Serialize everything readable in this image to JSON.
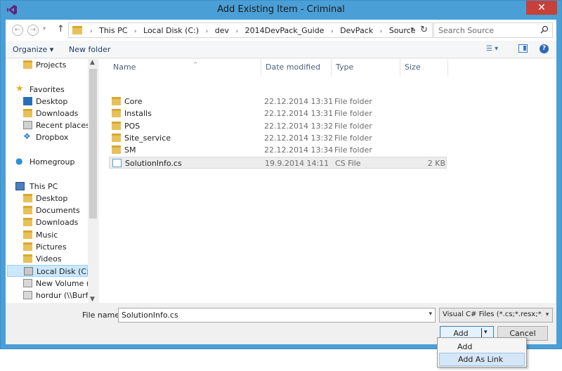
{
  "window": {
    "title": "Add Existing Item - Criminal",
    "close_glyph": "✕"
  },
  "address": {
    "crumbs": [
      "This PC",
      "Local Disk (C:)",
      "dev",
      "2014DevPack_Guide",
      "DevPack",
      "Source"
    ],
    "search_placeholder": "Search Source"
  },
  "toolbar": {
    "organize": "Organize ▾",
    "new_folder": "New folder"
  },
  "nav": {
    "items": [
      {
        "label": "Projects",
        "icon": "folder-icon"
      },
      {
        "label": "Favorites",
        "icon": "star-icon"
      },
      {
        "label": "Desktop",
        "icon": "desktop-icon"
      },
      {
        "label": "Downloads",
        "icon": "downloads-icon"
      },
      {
        "label": "Recent places",
        "icon": "recent-places-icon"
      },
      {
        "label": "Dropbox",
        "icon": "dropbox-icon"
      },
      {
        "label": "Homegroup",
        "icon": "homegroup-icon"
      },
      {
        "label": "This PC",
        "icon": "computer-icon"
      },
      {
        "label": "Desktop",
        "icon": "desktop-icon"
      },
      {
        "label": "Documents",
        "icon": "documents-icon"
      },
      {
        "label": "Downloads",
        "icon": "downloads-icon"
      },
      {
        "label": "Music",
        "icon": "music-icon"
      },
      {
        "label": "Pictures",
        "icon": "pictures-icon"
      },
      {
        "label": "Videos",
        "icon": "videos-icon"
      },
      {
        "label": "Local Disk (C:)",
        "icon": "drive-icon"
      },
      {
        "label": "New Volume (D:)",
        "icon": "drive-icon"
      },
      {
        "label": "hordur (\\\\Burfell.",
        "icon": "network-drive-icon"
      }
    ]
  },
  "files": {
    "columns": [
      "Name",
      "Date modified",
      "Type",
      "Size"
    ],
    "rows": [
      {
        "name": "Core",
        "date": "22.12.2014 13:31",
        "type": "File folder",
        "size": "",
        "icon": "folder-icon"
      },
      {
        "name": "Installs",
        "date": "22.12.2014 13:31",
        "type": "File folder",
        "size": "",
        "icon": "folder-icon"
      },
      {
        "name": "POS",
        "date": "22.12.2014 13:32",
        "type": "File folder",
        "size": "",
        "icon": "folder-icon"
      },
      {
        "name": "Site_service",
        "date": "22.12.2014 13:32",
        "type": "File folder",
        "size": "",
        "icon": "folder-icon"
      },
      {
        "name": "SM",
        "date": "22.12.2014 13:34",
        "type": "File folder",
        "size": "",
        "icon": "folder-icon"
      },
      {
        "name": "SolutionInfo.cs",
        "date": "19.9.2014 14:11",
        "type": "CS File",
        "size": "2 KB",
        "icon": "cs-file-icon"
      }
    ]
  },
  "footer": {
    "file_name_label": "File name:",
    "file_name_value": "SolutionInfo.cs",
    "file_type": "Visual C# Files (*.cs;*.resx;*.resw",
    "add_label": "Add",
    "cancel_label": "Cancel"
  },
  "add_menu": {
    "items": [
      "Add",
      "Add As Link"
    ]
  }
}
